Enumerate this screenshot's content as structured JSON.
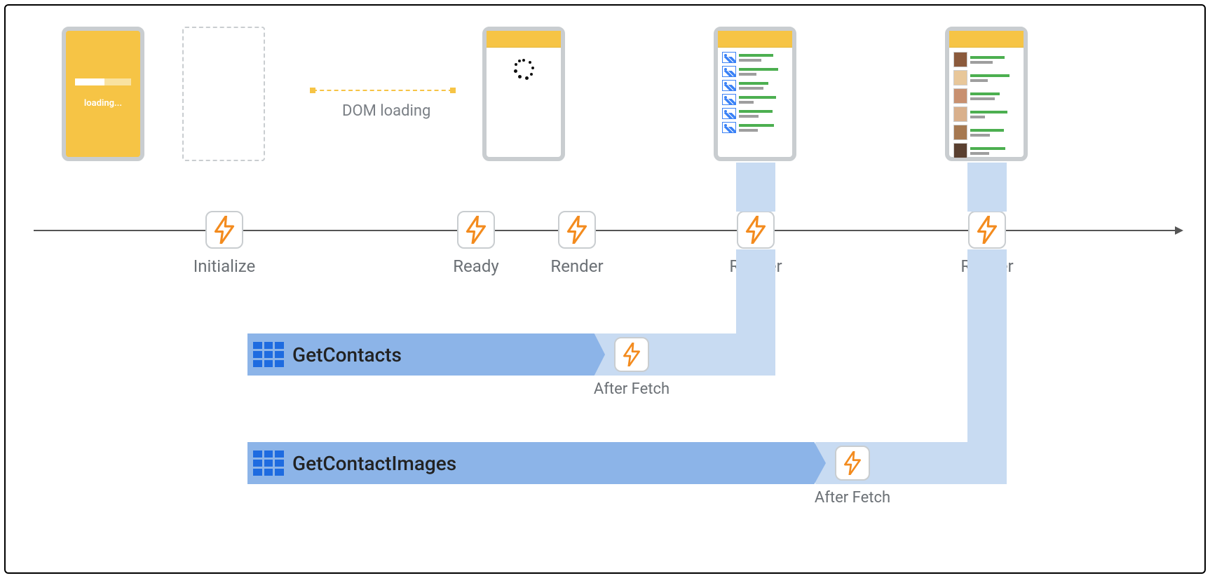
{
  "phones": {
    "loading_text": "loading...",
    "dom_label": "DOM loading"
  },
  "timeline": {
    "events": [
      {
        "label": "Initialize"
      },
      {
        "label": "Ready"
      },
      {
        "label": "Render"
      },
      {
        "label": "Render"
      },
      {
        "label": "Render"
      }
    ]
  },
  "fetches": [
    {
      "name": "GetContacts",
      "after_label": "After Fetch"
    },
    {
      "name": "GetContactImages",
      "after_label": "After Fetch"
    }
  ]
}
